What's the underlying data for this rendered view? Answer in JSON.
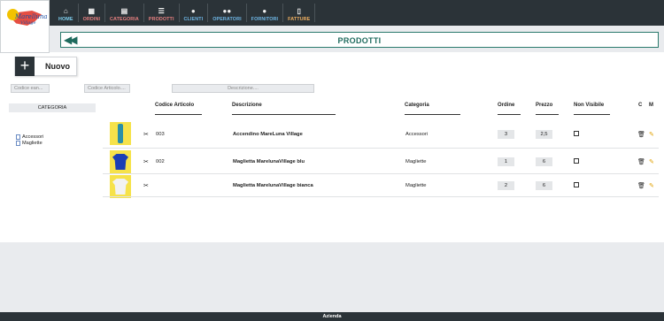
{
  "logo": {
    "word": "Marelluna",
    "word2": "Village"
  },
  "nav": [
    {
      "label": "HOME",
      "icon": "home-icon",
      "glyph": "⌂",
      "color": "#7fd0f0"
    },
    {
      "label": "ORDINI",
      "icon": "calendar-icon",
      "glyph": "▦",
      "color": "#e88080"
    },
    {
      "label": "CATEGORIA",
      "icon": "table-icon",
      "glyph": "▤",
      "color": "#e88080"
    },
    {
      "label": "PRODOTTI",
      "icon": "list-icon",
      "glyph": "☰",
      "color": "#e88080"
    },
    {
      "label": "CLIENTI",
      "icon": "user-icon",
      "glyph": "●",
      "color": "#6fb8e8"
    },
    {
      "label": "OPERATORI",
      "icon": "users-icon",
      "glyph": "●●",
      "color": "#6fb8e8"
    },
    {
      "label": "FORNITORI",
      "icon": "user-icon",
      "glyph": "●",
      "color": "#6fb8e8"
    },
    {
      "label": "FATTURE",
      "icon": "file-icon",
      "glyph": "▯",
      "color": "#f0b060"
    }
  ],
  "page": {
    "title": "PRODOTTI",
    "new_label": "Nuovo"
  },
  "filters": {
    "code_ean": "Codice ean...",
    "code_article": "Codice Articolo....",
    "description": "Descrizione...."
  },
  "sidebar": {
    "title": "CATEGORIA",
    "items": [
      "Accessori",
      "Magliette"
    ]
  },
  "table": {
    "headers": {
      "code": "Codice Articolo",
      "description": "Descrizione",
      "category": "Categoria",
      "order": "Ordine",
      "price": "Prezzo",
      "hidden": "Non Visibile",
      "c": "C",
      "m": "M"
    },
    "rows": [
      {
        "code": "003",
        "description": "Accendino MareLuna Village",
        "category": "Accessori",
        "order": "3",
        "price": "2,5"
      },
      {
        "code": "002",
        "description": "Maglietta MarelunaVillage blu",
        "category": "Magliette",
        "order": "1",
        "price": "6"
      },
      {
        "code": "",
        "description": "Maglietta MarelunaVillage bianca",
        "category": "Magliette",
        "order": "2",
        "price": "6"
      }
    ]
  },
  "footer": {
    "label": "Azienda"
  },
  "colors": {
    "topbar": "#2b3338",
    "accent": "#1f6b5e",
    "thumb_bg": "#f6e24a"
  }
}
